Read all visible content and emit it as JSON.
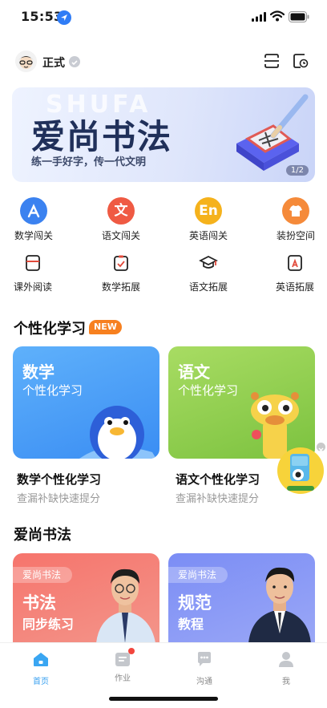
{
  "status_bar": {
    "time": "15:53"
  },
  "header": {
    "mode_label": "正式"
  },
  "banner": {
    "bg_text": "SHUFA",
    "title": "爱尚书法",
    "subtitle": "练一手好字，传一代文明",
    "page_indicator": "1/2"
  },
  "grid": {
    "row1": [
      {
        "label": "数学闯关",
        "icon": "app-store-icon",
        "color": "#3b82f0",
        "glyph": ""
      },
      {
        "label": "语文闯关",
        "icon": "chinese-wen-icon",
        "color": "#ef5a43",
        "glyph": "文"
      },
      {
        "label": "英语闯关",
        "icon": "english-en-icon",
        "color": "#f5b21c",
        "glyph": "En"
      },
      {
        "label": "装扮空间",
        "icon": "tshirt-icon",
        "color": "#f58a3a",
        "glyph": ""
      }
    ],
    "row2": [
      {
        "label": "课外阅读",
        "icon": "book-icon"
      },
      {
        "label": "数学拓展",
        "icon": "clipboard-check-icon"
      },
      {
        "label": "语文拓展",
        "icon": "graduation-cap-icon"
      },
      {
        "label": "英语拓展",
        "icon": "document-a-icon"
      }
    ]
  },
  "personalized": {
    "section_title": "个性化学习",
    "badge": "NEW",
    "cards": [
      {
        "title": "数学",
        "subtitle": "个性化学习",
        "name": "数学个性化学习",
        "desc": "查漏补缺快速提分"
      },
      {
        "title": "语文",
        "subtitle": "个性化学习",
        "name": "语文个性化学习",
        "desc": "查漏补缺快速提分"
      }
    ]
  },
  "calligraphy": {
    "section_title": "爱尚书法",
    "cards": [
      {
        "tag": "爱尚书法",
        "line1": "书法",
        "line2": "同步练习"
      },
      {
        "tag": "爱尚书法",
        "line1": "规范",
        "line2": "教程"
      }
    ]
  },
  "tabbar": {
    "tabs": [
      {
        "label": "首页",
        "active": true
      },
      {
        "label": "作业",
        "active": false
      },
      {
        "label": "沟通",
        "active": false
      },
      {
        "label": "我",
        "active": false
      }
    ]
  },
  "colors": {
    "accent": "#38a0f0",
    "badge": "#f7801f",
    "math_card": "#4a9ff6",
    "chinese_card": "#94d052"
  }
}
